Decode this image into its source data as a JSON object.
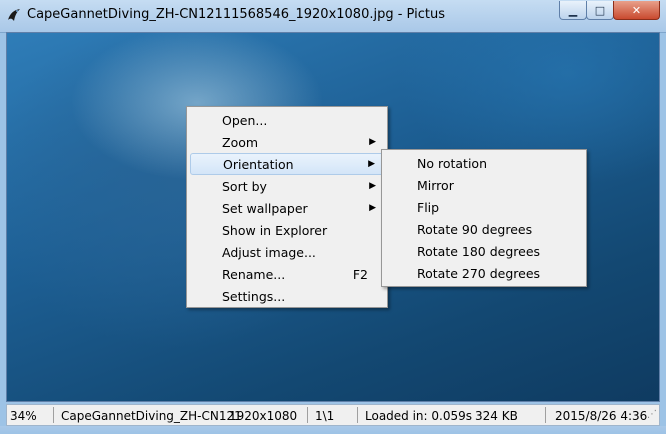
{
  "window": {
    "title": "CapeGannetDiving_ZH-CN12111568546_1920x1080.jpg - Pictus",
    "minimize": "▁",
    "maximize": "□",
    "close": "✕"
  },
  "context_menu": {
    "items": [
      {
        "label": "Open...",
        "arrow": "",
        "shortcut": ""
      },
      {
        "label": "Zoom",
        "arrow": "▶",
        "shortcut": ""
      },
      {
        "label": "Orientation",
        "arrow": "▶",
        "shortcut": ""
      },
      {
        "label": "Sort by",
        "arrow": "▶",
        "shortcut": ""
      },
      {
        "label": "Set wallpaper",
        "arrow": "▶",
        "shortcut": ""
      },
      {
        "label": "Show in Explorer",
        "arrow": "",
        "shortcut": ""
      },
      {
        "label": "Adjust image...",
        "arrow": "",
        "shortcut": ""
      },
      {
        "label": "Rename...",
        "arrow": "",
        "shortcut": "F2"
      },
      {
        "label": "Settings...",
        "arrow": "",
        "shortcut": ""
      }
    ]
  },
  "orientation_submenu": {
    "items": [
      {
        "label": "No rotation"
      },
      {
        "label": "Mirror"
      },
      {
        "label": "Flip"
      },
      {
        "label": "Rotate 90 degrees"
      },
      {
        "label": "Rotate 180 degrees"
      },
      {
        "label": "Rotate 270 degrees"
      }
    ]
  },
  "status": {
    "zoom": "34%",
    "filename": "CapeGannetDiving_ZH-CN121",
    "dimensions": "1920x1080",
    "index": "1\\1",
    "load_time": "Loaded in: 0.059s",
    "size": "324 KB",
    "date": "2015/8/26 4:36"
  },
  "colors": {
    "titlebar": "#a9c8e8",
    "menu_bg": "#f0f0f0",
    "highlight": "#d3e5f8",
    "close_button": "#c94a2f"
  }
}
